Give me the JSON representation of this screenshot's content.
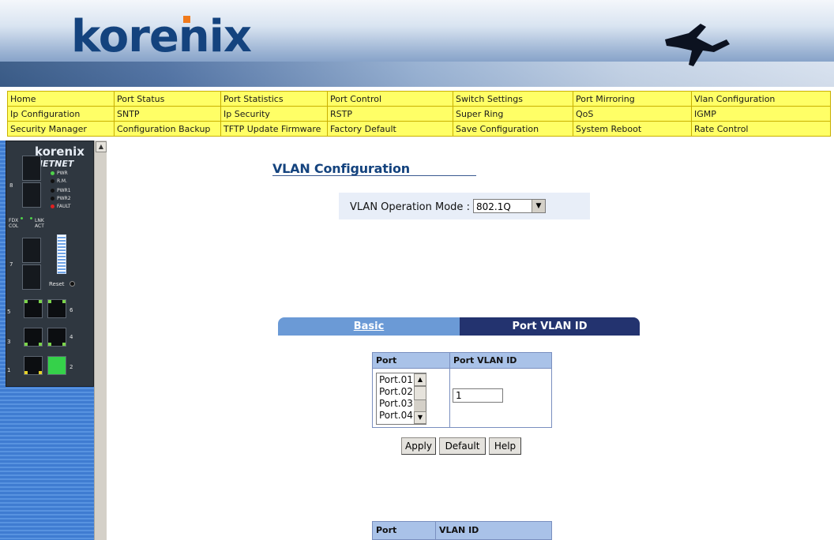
{
  "banner": {
    "brand": "korenix"
  },
  "nav": [
    [
      "Home",
      "Port Status",
      "Port Statistics",
      "Port Control",
      "Switch Settings",
      "Port Mirroring",
      "Vlan Configuration"
    ],
    [
      "Ip Configuration",
      "SNTP",
      "Ip Security",
      "RSTP",
      "Super Ring",
      "QoS",
      "IGMP"
    ],
    [
      "Security Manager",
      "Configuration Backup",
      "TFTP Update Firmware",
      "Factory Default",
      "Save Configuration",
      "System Reboot",
      "Rate Control"
    ]
  ],
  "device": {
    "brand": "korenix",
    "model": "JETNET",
    "leds": [
      "PWR",
      "R.M.",
      "PWR1",
      "PWR2",
      "FAULT"
    ],
    "legend": [
      "FDX",
      "COL",
      "LNK",
      "ACT"
    ],
    "reset": "Reset",
    "port_numbers": [
      "8",
      "7",
      "5",
      "6",
      "3",
      "4",
      "1",
      "2"
    ]
  },
  "page": {
    "title": "VLAN Configuration",
    "mode_label": "VLAN Operation Mode :",
    "mode_value": "802.1Q"
  },
  "tabs": {
    "basic": "Basic",
    "pvid": "Port VLAN ID"
  },
  "pvid_table": {
    "col_port": "Port",
    "col_pvid": "Port VLAN ID",
    "ports": [
      "Port.01",
      "Port.02",
      "Port.03",
      "Port.04"
    ],
    "pvid_value": "1"
  },
  "buttons": {
    "apply": "Apply",
    "default": "Default",
    "help": "Help"
  },
  "bottom_table": {
    "col_port": "Port",
    "col_vlan": "VLAN ID"
  },
  "colors": {
    "nav_bg": "#ffff66",
    "tab_active": "#23336f",
    "tab_inactive": "#6b9ad6",
    "title": "#14437e"
  }
}
